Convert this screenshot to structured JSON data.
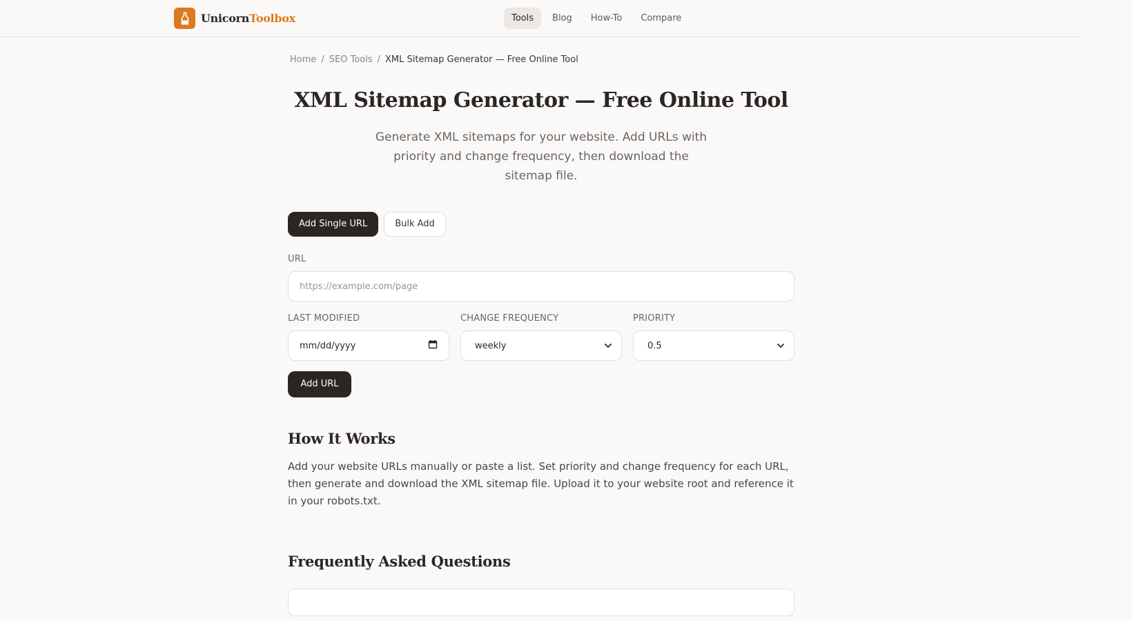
{
  "brand": {
    "name_part1": "Unicorn",
    "name_part2": "Toolbox",
    "accent": "#dc7a1e"
  },
  "nav": {
    "items": [
      {
        "label": "Tools",
        "active": true
      },
      {
        "label": "Blog"
      },
      {
        "label": "How-To"
      },
      {
        "label": "Compare"
      }
    ]
  },
  "breadcrumb": {
    "home": "Home",
    "section": "SEO Tools",
    "current": "XML Sitemap Generator — Free Online Tool"
  },
  "page": {
    "title": "XML Sitemap Generator — Free Online Tool",
    "subtitle": "Generate XML sitemaps for your website. Add URLs with priority and change frequency, then download the sitemap file."
  },
  "tabs": [
    {
      "label": "Add Single URL",
      "active": true
    },
    {
      "label": "Bulk Add"
    }
  ],
  "form": {
    "url_label": "URL",
    "url_placeholder": "https://example.com/page",
    "url_value": "",
    "last_modified_label": "LAST MODIFIED",
    "last_modified_placeholder": "mm/dd/yyyy",
    "change_frequency_label": "CHANGE FREQUENCY",
    "change_frequency_value": "weekly",
    "priority_label": "PRIORITY",
    "priority_value": "0.5",
    "add_button": "Add URL"
  },
  "how_it_works": {
    "heading": "How It Works",
    "text": "Add your website URLs manually or paste a list. Set priority and change frequency for each URL, then generate and download the XML sitemap file. Upload it to your website root and reference it in your robots.txt."
  },
  "faq": {
    "heading": "Frequently Asked Questions"
  },
  "icons": {
    "logo": "bottle-icon",
    "calendar": "calendar-icon",
    "select_arrow": "chevron-down-icon"
  }
}
